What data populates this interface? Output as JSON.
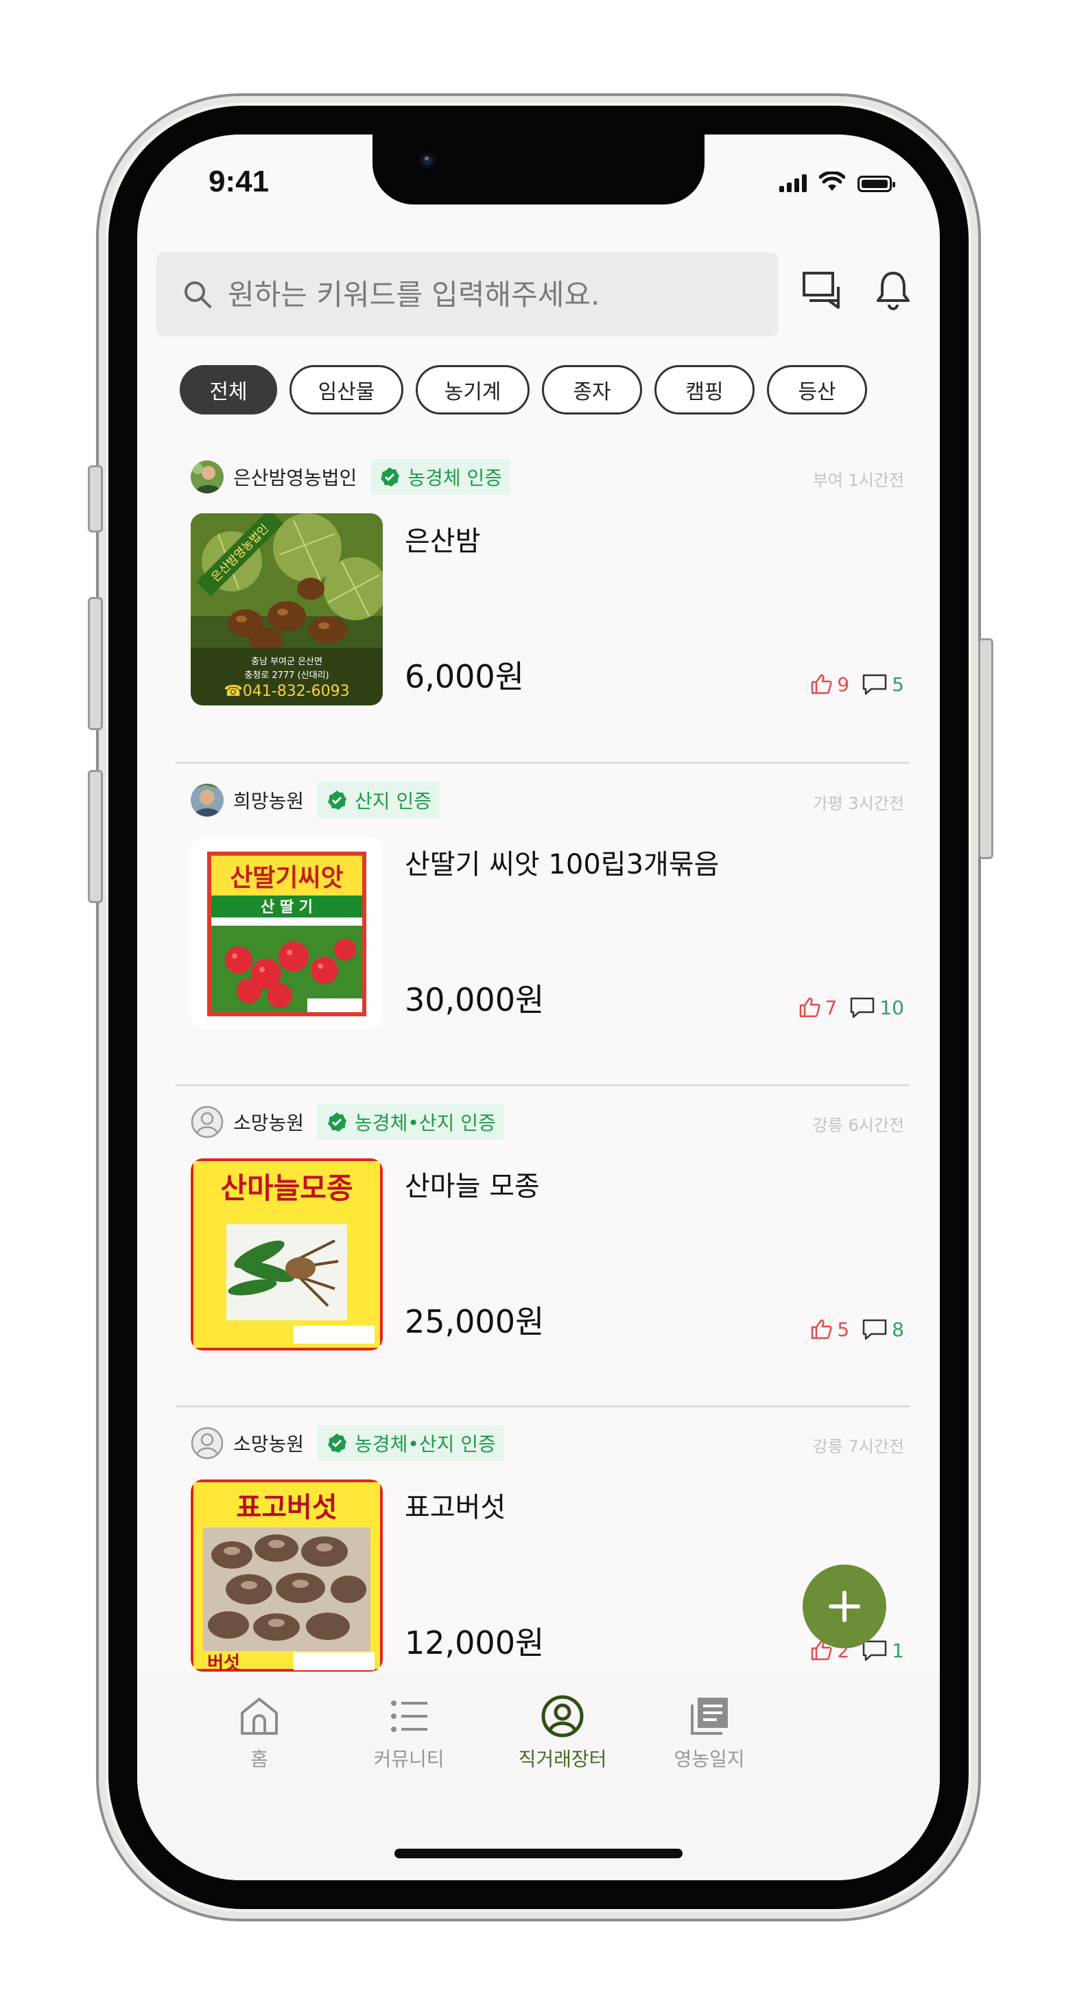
{
  "status_bar": {
    "time": "9:41"
  },
  "search": {
    "placeholder": "원하는 키워드를 입력해주세요."
  },
  "header_icons": [
    "chat-icon",
    "bell-icon",
    "search-icon"
  ],
  "filters": [
    {
      "label": "전체",
      "active": true
    },
    {
      "label": "임산물",
      "active": false
    },
    {
      "label": "농기계",
      "active": false
    },
    {
      "label": "종자",
      "active": false
    },
    {
      "label": "캠핑",
      "active": false
    },
    {
      "label": "등산",
      "active": false
    }
  ],
  "products": [
    {
      "seller": "은산밤영농법인",
      "badge": "농경체 인증",
      "meta": "부여 1시간전",
      "title": "은산밤",
      "price": "6,000원",
      "likes": "9",
      "comments": "5"
    },
    {
      "seller": "희망농원",
      "badge": "산지 인증",
      "meta": "가평 3시간전",
      "title": "산딸기 씨앗 100립3개묶음",
      "price": "30,000원",
      "likes": "7",
      "comments": "10"
    },
    {
      "seller": "소망농원",
      "badge": "농경체•산지 인증",
      "meta": "강릉 6시간전",
      "title": "산마늘 모종",
      "price": "25,000원",
      "likes": "5",
      "comments": "8"
    },
    {
      "seller": "소망농원",
      "badge": "농경체•산지 인증",
      "meta": "강릉 7시간전",
      "title": "표고버섯",
      "price": "12,000원",
      "likes": "2",
      "comments": "1"
    }
  ],
  "thumb_text": {
    "chestnut_banner": "은산밤영농법인",
    "chestnut_addr1": "충남 부여군 은산면",
    "chestnut_addr2": "충청로 2777 (신대리)",
    "chestnut_phone": "☎041-832-6093",
    "strawberry_title": "산딸기씨앗",
    "strawberry_sub": "산 딸 기",
    "garlic_title": "산마늘모종",
    "mushroom_title": "표고버섯",
    "mushroom_bottom": "버섯"
  },
  "tabs": [
    {
      "label": "홈",
      "icon": "home-icon",
      "active": false
    },
    {
      "label": "커뮤니티",
      "icon": "list-icon",
      "active": false
    },
    {
      "label": "직거래장터",
      "icon": "user-circle-icon",
      "active": true
    },
    {
      "label": "영농일지",
      "icon": "journal-icon",
      "active": false
    }
  ],
  "colors": {
    "accent_green": "#6b8e37",
    "badge_green": "#1e9a4c",
    "like_red": "#e24b4b",
    "active_tab": "#446a28"
  }
}
